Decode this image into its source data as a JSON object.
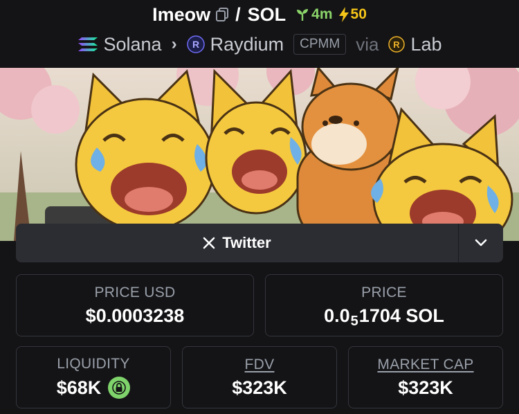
{
  "header": {
    "token_name": "Imeow",
    "separator": "/",
    "quote": "SOL",
    "age": "4m",
    "boosts": "50",
    "chain": "Solana",
    "dex": "Raydium",
    "pool_type": "CPMM",
    "via": "via",
    "launchpad": "Lab"
  },
  "social": {
    "twitter_label": "Twitter"
  },
  "stats": {
    "price_usd_label": "PRICE USD",
    "price_usd": "$0.0003238",
    "price_label": "PRICE",
    "price_prefix": "0.0",
    "price_zeros": "5",
    "price_rest": "1704 SOL",
    "liquidity_label": "LIQUIDITY",
    "liquidity": "$68K",
    "fdv_label": "FDV",
    "fdv": "$323K",
    "mcap_label": "MARKET CAP",
    "mcap": "$323K"
  },
  "colors": {
    "background": "#141416",
    "age_green": "#8bd46a",
    "boost_yellow": "#f5c518",
    "lock_green": "#7fd36b"
  }
}
